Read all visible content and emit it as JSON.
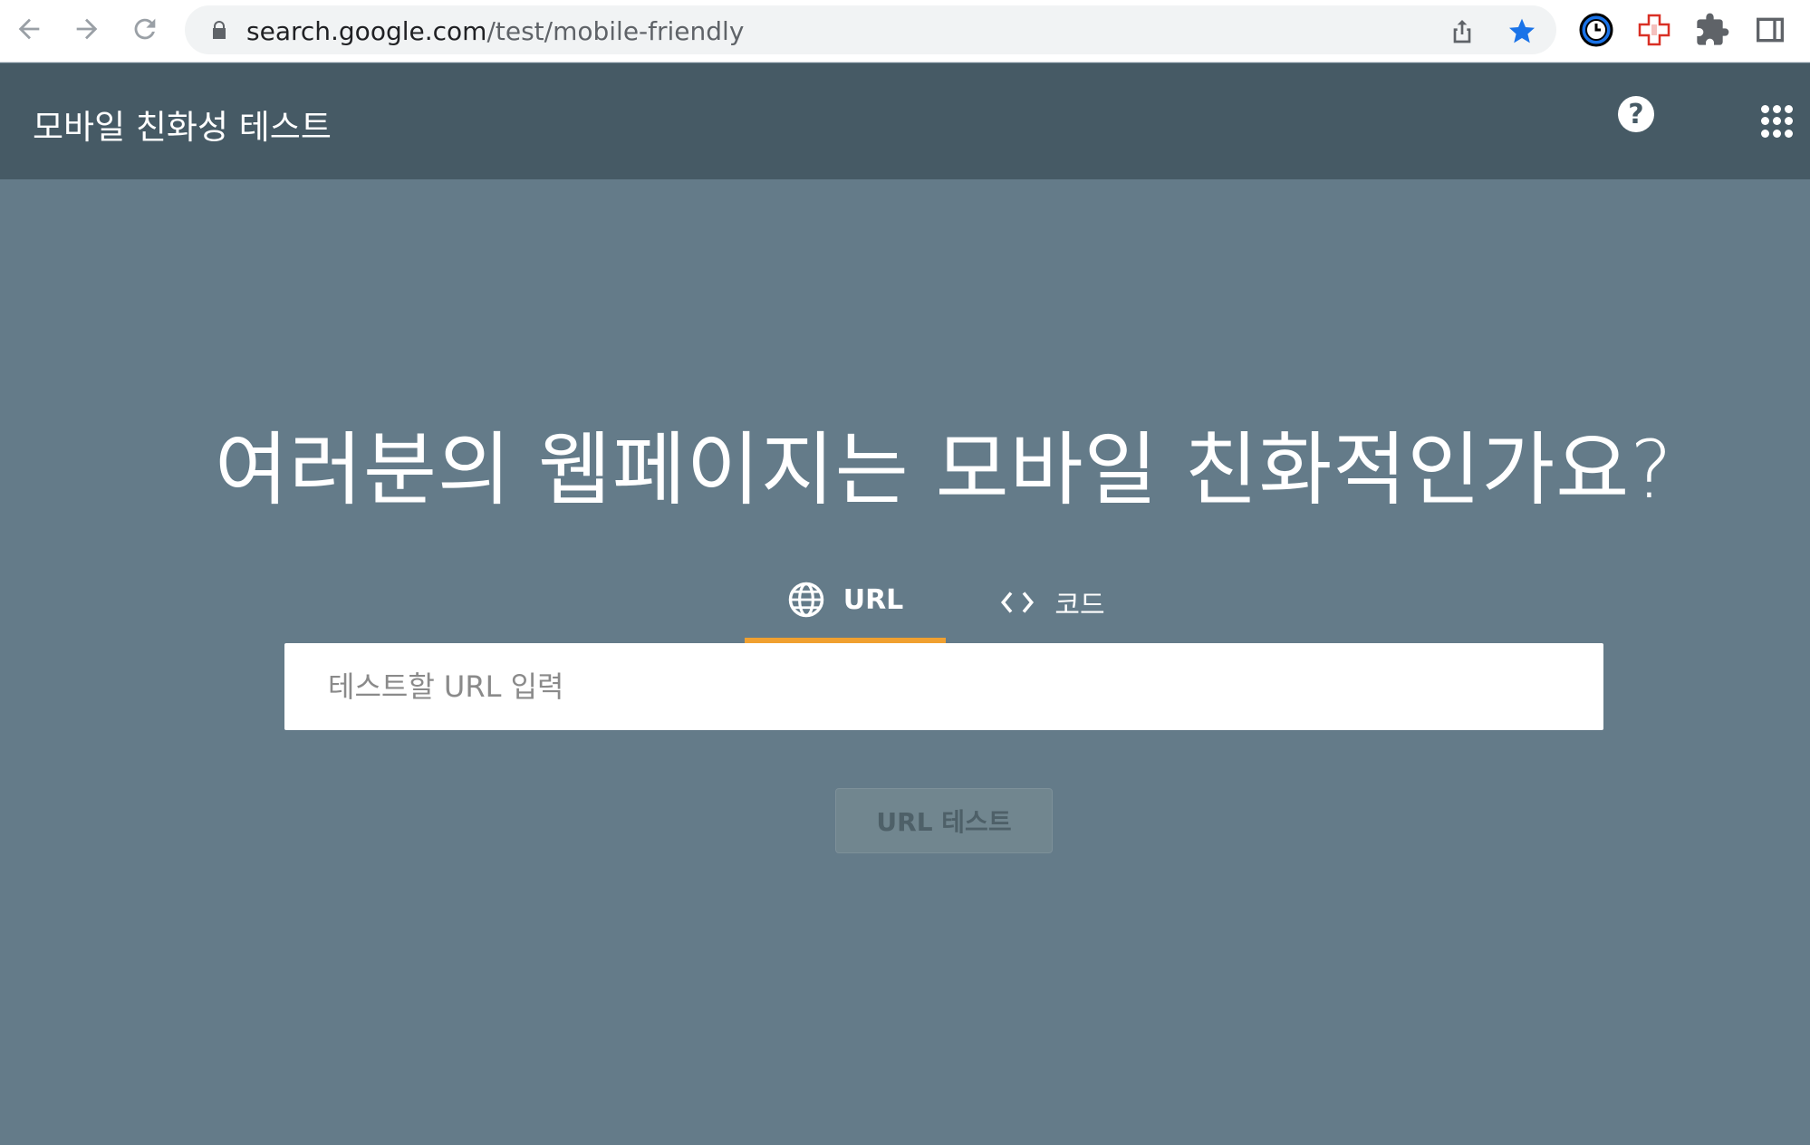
{
  "browser": {
    "url_domain": "search.google.com",
    "url_path": "/test/mobile-friendly",
    "icons": [
      "back-arrow-icon",
      "forward-arrow-icon",
      "reload-icon",
      "lock-icon",
      "share-icon",
      "star-icon",
      "clock-extension-icon",
      "red-cross-extension-icon",
      "puzzle-extensions-icon",
      "side-panel-icon"
    ],
    "star_color": "#1a73e8"
  },
  "header": {
    "title": "모바일 친화성 테스트",
    "help_label": "?",
    "bg_color": "#465a65"
  },
  "main": {
    "headline": "여러분의 웹페이지는 모바일 친화적인가요?",
    "tabs": [
      {
        "label": "URL",
        "icon": "globe-icon",
        "selected": true
      },
      {
        "label": "코드",
        "icon": "code-brackets-icon",
        "selected": false
      }
    ],
    "input_placeholder": "테스트할 URL 입력",
    "input_value": "",
    "submit_label": "URL 테스트",
    "accent_color": "#f0a030",
    "bg_color": "#647b89"
  }
}
